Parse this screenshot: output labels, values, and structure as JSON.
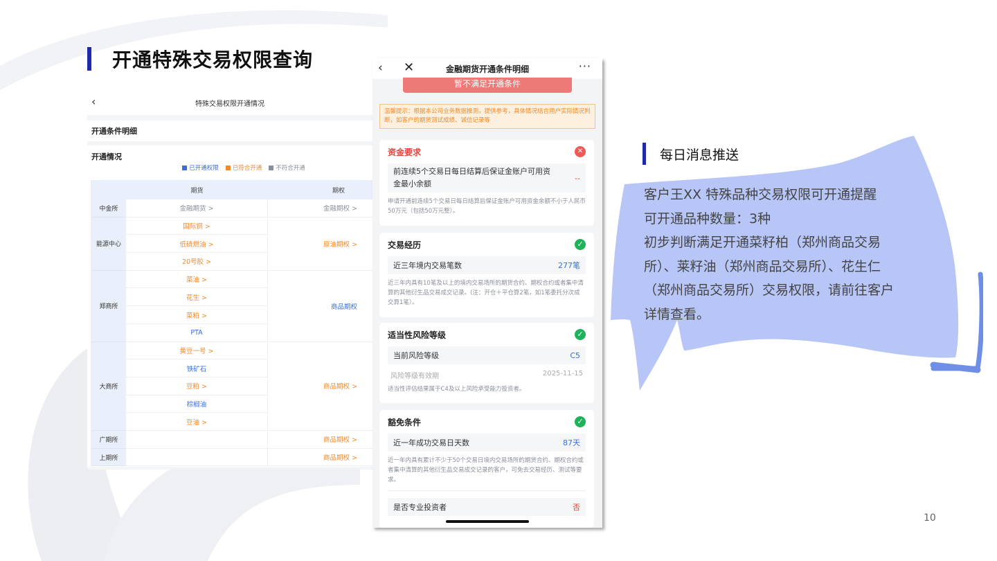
{
  "slide": {
    "title": "开通特殊交易权限查询",
    "page_number": "10"
  },
  "left_screen": {
    "nav_title": "特殊交易权限开通情况",
    "section_conditions": "开通条件明细",
    "section_status": "开通情况",
    "legend": [
      "已开通权限",
      "已符合开通",
      "不符合开通"
    ],
    "legend_colors": [
      "#3a6fd8",
      "#f08a2a",
      "#8a8f99"
    ],
    "headers": [
      "期货",
      "期权"
    ],
    "rows": [
      {
        "exchange": "中金所",
        "futures": [
          {
            "text": "金融期货 >",
            "status": "grey"
          }
        ],
        "options": {
          "text": "金融期权 >",
          "status": "grey"
        }
      },
      {
        "exchange": "能源中心",
        "futures": [
          {
            "text": "国际铜 >",
            "status": "orange"
          },
          {
            "text": "低硫燃油 >",
            "status": "orange"
          },
          {
            "text": "20号胶 >",
            "status": "orange"
          }
        ],
        "options": {
          "text": "原油期权 >",
          "status": "orange"
        }
      },
      {
        "exchange": "郑商所",
        "futures": [
          {
            "text": "菜油 >",
            "status": "orange"
          },
          {
            "text": "花生 >",
            "status": "orange"
          },
          {
            "text": "菜粕 >",
            "status": "orange"
          },
          {
            "text": "PTA",
            "status": "blue"
          }
        ],
        "options": {
          "text": "商品期权",
          "status": "blue"
        }
      },
      {
        "exchange": "大商所",
        "futures": [
          {
            "text": "黄豆一号 >",
            "status": "orange"
          },
          {
            "text": "铁矿石",
            "status": "blue"
          },
          {
            "text": "豆粕 >",
            "status": "orange"
          },
          {
            "text": "棕榈油",
            "status": "blue"
          },
          {
            "text": "豆油 >",
            "status": "orange"
          }
        ],
        "options": {
          "text": "商品期权 >",
          "status": "orange"
        }
      },
      {
        "exchange": "广期所",
        "futures": [],
        "options": {
          "text": "商品期权 >",
          "status": "orange"
        }
      },
      {
        "exchange": "上期所",
        "futures": [],
        "options": {
          "text": "商品期权 >",
          "status": "orange"
        }
      }
    ]
  },
  "phone": {
    "nav_title": "金融期货开通条件明细",
    "more_label": "···",
    "not_met_button": "暂不满足开通条件",
    "tip": "温馨提示：根据本公司业务数据推测，提供参考，具体情况结合用户实际情况判断，如客户的期货测试成绩、诚信记录等",
    "cards": {
      "funds": {
        "title": "资金要求",
        "item": "前连续5个交易日每日结算后保证金账户可用资金最小余额",
        "value": "--",
        "note": "申请开通前连续5个交易日每日结算后保证金账户可用资金余额不小于人民币50万元（包括50万元整）。"
      },
      "experience": {
        "title": "交易经历",
        "item": "近三年境内交易笔数",
        "value": "277笔",
        "note": "近三年内具有10笔及以上的境内交易场所的期货合约、期权合约或者集中清算的其他衍生品交易成交记录。(注：开仓＋平仓算2笔，如1笔委托分次成交算1笔）。"
      },
      "risk": {
        "title": "适当性风险等级",
        "item": "当前风险等级",
        "value": "C5",
        "sub_label": "风险等级有效期",
        "sub_value": "2025-11-15",
        "note": "适当性评估结果属于C4及以上风险承受能力投资者。"
      },
      "exempt": {
        "title": "豁免条件",
        "item": "近一年成功交易日天数",
        "value": "87天",
        "note": "近一年内具有累计不少于50个交易日境内交易场所的期货合约、期权合约或者集中清算的其他衍生品交易成交记录的客户，可免去交易经历、测试等要求。",
        "item2": "是否专业投资者",
        "value2": "否"
      }
    }
  },
  "message": {
    "title": "每日消息推送",
    "lines": [
      "客户王XX 特殊品种交易权限可开通提醒",
      "可开通品种数量：3种",
      "初步判断满足开通菜籽柏（郑州商品交易",
      "所）、莱籽油（郑州商品交易所）、花生仁",
      "（郑州商品交易所）交易权限，请前往客户",
      "详情查看。"
    ],
    "bubble_color": "#b7c6f6"
  }
}
